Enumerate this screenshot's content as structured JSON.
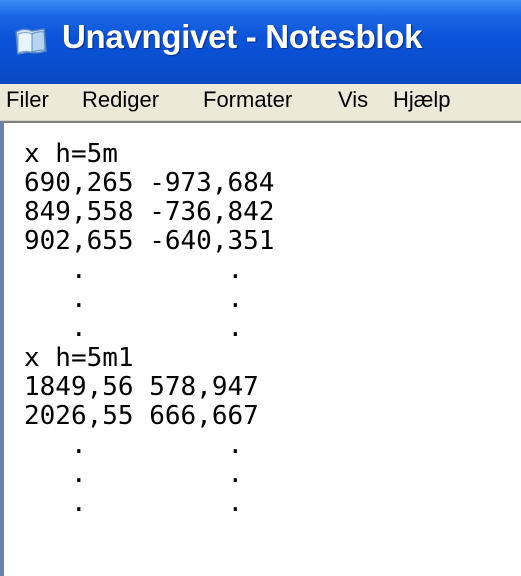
{
  "window": {
    "title": "Unavngivet - Notesblok",
    "icon": "notepad-icon"
  },
  "menu": {
    "items": [
      "Filer",
      "Rediger",
      "Formater",
      "Vis",
      "Hjælp"
    ]
  },
  "editor": {
    "lines": [
      "x h=5m",
      "690,265 -973,684",
      "849,558 -736,842",
      "902,655 -640,351",
      "   .         .",
      "   .         .",
      "   .         .",
      "x h=5m1",
      "1849,56 578,947",
      "2026,55 666,667",
      "   .         .",
      "   .         .",
      "   .         ."
    ]
  }
}
